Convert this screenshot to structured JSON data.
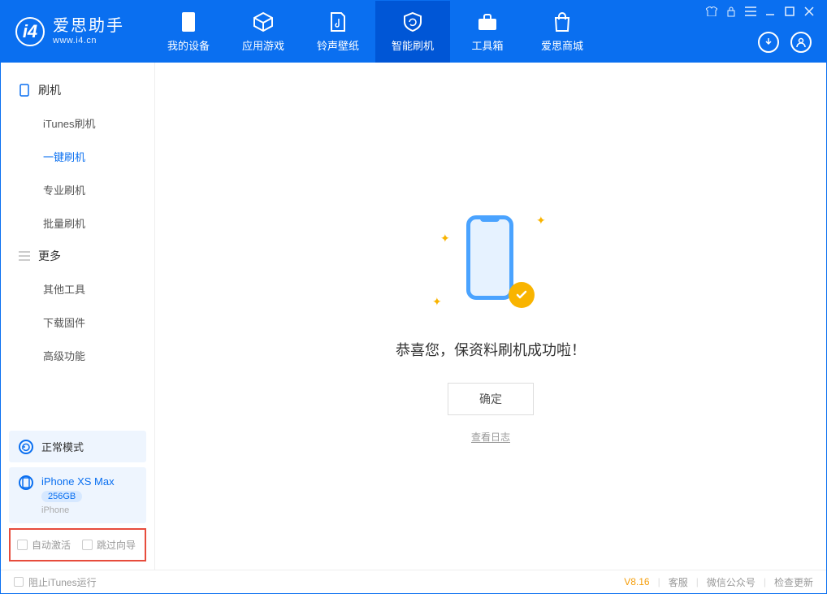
{
  "app": {
    "brand": "爱思助手",
    "url": "www.i4.cn"
  },
  "tabs": [
    {
      "label": "我的设备"
    },
    {
      "label": "应用游戏"
    },
    {
      "label": "铃声壁纸"
    },
    {
      "label": "智能刷机"
    },
    {
      "label": "工具箱"
    },
    {
      "label": "爱思商城"
    }
  ],
  "sidebar": {
    "section1": "刷机",
    "items1": [
      {
        "label": "iTunes刷机"
      },
      {
        "label": "一键刷机"
      },
      {
        "label": "专业刷机"
      },
      {
        "label": "批量刷机"
      }
    ],
    "section2": "更多",
    "items2": [
      {
        "label": "其他工具"
      },
      {
        "label": "下载固件"
      },
      {
        "label": "高级功能"
      }
    ],
    "mode": "正常模式",
    "device": {
      "name": "iPhone XS Max",
      "storage": "256GB",
      "type": "iPhone"
    },
    "check1": "自动激活",
    "check2": "跳过向导"
  },
  "main": {
    "message": "恭喜您，保资料刷机成功啦！",
    "ok": "确定",
    "log": "查看日志"
  },
  "footer": {
    "block_itunes": "阻止iTunes运行",
    "version": "V8.16",
    "link1": "客服",
    "link2": "微信公众号",
    "link3": "检查更新"
  }
}
